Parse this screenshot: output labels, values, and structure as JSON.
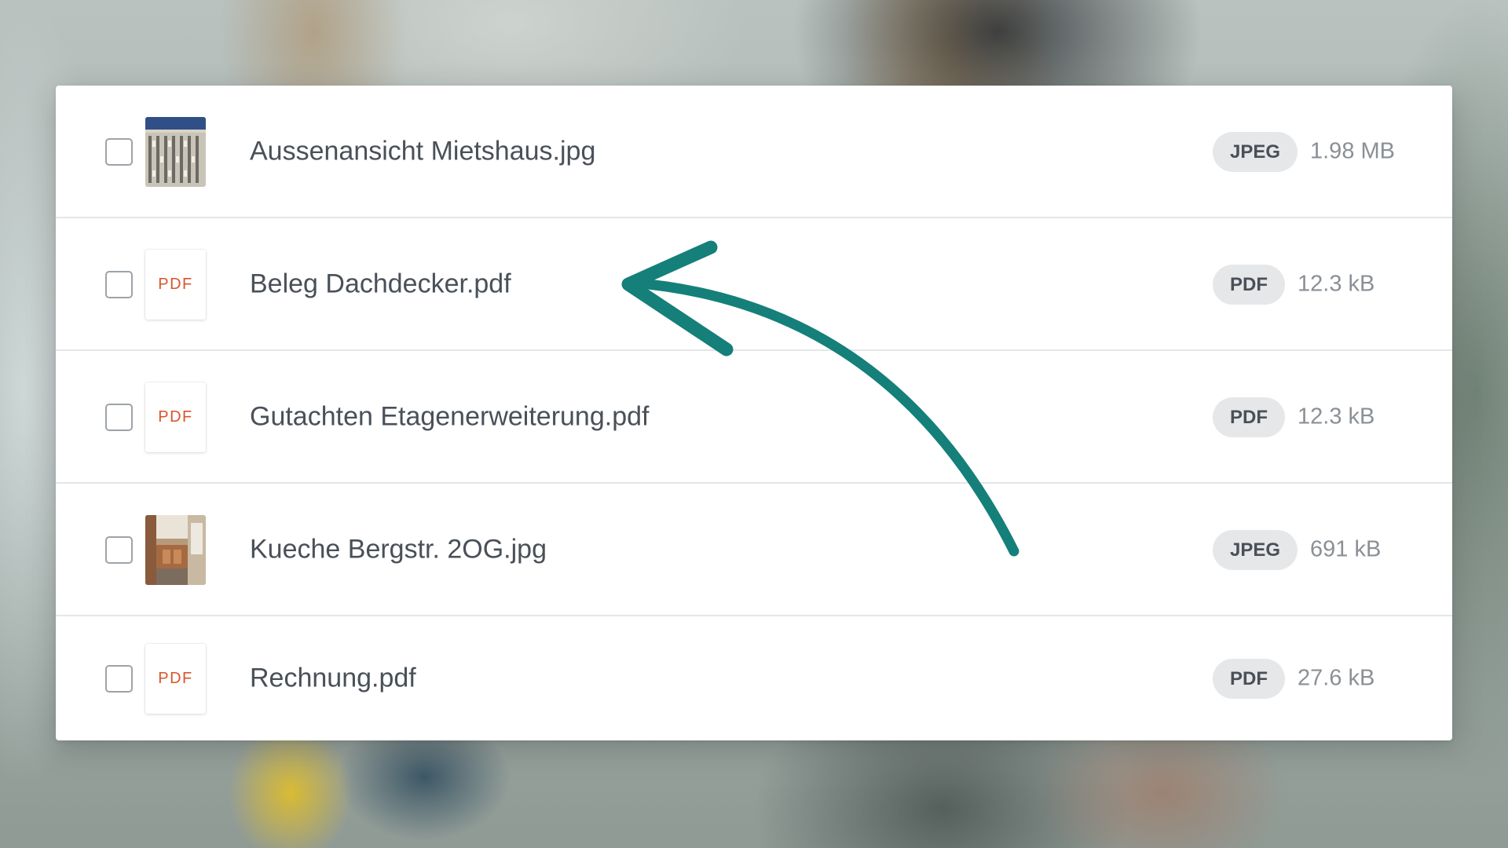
{
  "files": [
    {
      "name": "Aussenansicht Mietshaus.jpg",
      "type": "JPEG",
      "size": "1.98 MB",
      "thumb": "photo-building"
    },
    {
      "name": "Beleg Dachdecker.pdf",
      "type": "PDF",
      "size": "12.3 kB",
      "thumb": "pdf",
      "thumb_label": "PDF"
    },
    {
      "name": "Gutachten Etagenerweiterung.pdf",
      "type": "PDF",
      "size": "12.3 kB",
      "thumb": "pdf",
      "thumb_label": "PDF"
    },
    {
      "name": "Kueche Bergstr. 2OG.jpg",
      "type": "JPEG",
      "size": "691 kB",
      "thumb": "photo-kitchen"
    },
    {
      "name": "Rechnung.pdf",
      "type": "PDF",
      "size": "27.6 kB",
      "thumb": "pdf",
      "thumb_label": "PDF"
    }
  ],
  "colors": {
    "arrow": "#157f7a",
    "pdf_label": "#d9542b",
    "badge_bg": "#e6e7e9"
  },
  "annotation": {
    "icon": "curved-arrow-icon"
  }
}
